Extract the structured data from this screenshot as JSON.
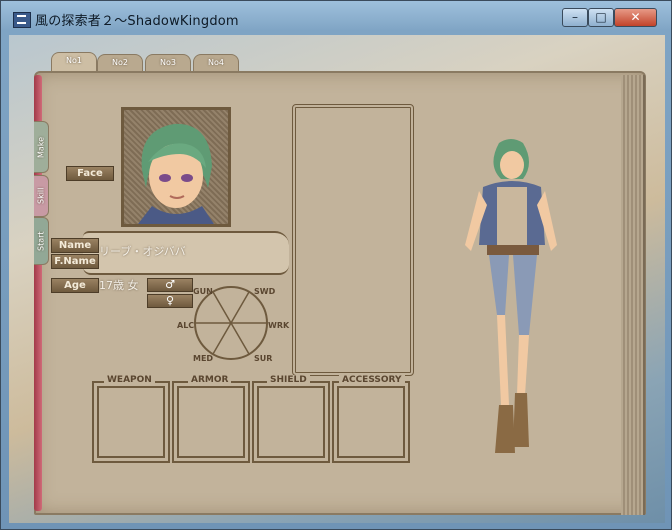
{
  "window": {
    "title": "風の探索者２～ShadowKingdom",
    "minimize": "–",
    "maximize": "□",
    "close": "✕"
  },
  "tabs": [
    "No1",
    "No2",
    "No3",
    "No4"
  ],
  "side_tabs": [
    "Make",
    "Skill",
    "Start"
  ],
  "labels": {
    "face": "Face",
    "name": "Name",
    "fname": "F.Name",
    "age": "Age"
  },
  "character": {
    "name_value": "リーブ・オジババ",
    "age_value": "17歳 女"
  },
  "gender": {
    "male": "♂",
    "female": "♀"
  },
  "stats": [
    "GUN",
    "SWD",
    "ALC",
    "WRK",
    "MED",
    "SUR"
  ],
  "equipment": [
    "WEAPON",
    "ARMOR",
    "SHIELD",
    "ACCESSORY"
  ],
  "colors": {
    "page": "#c2b39b",
    "ink": "#6e5a3e",
    "button": "#7e6648"
  }
}
